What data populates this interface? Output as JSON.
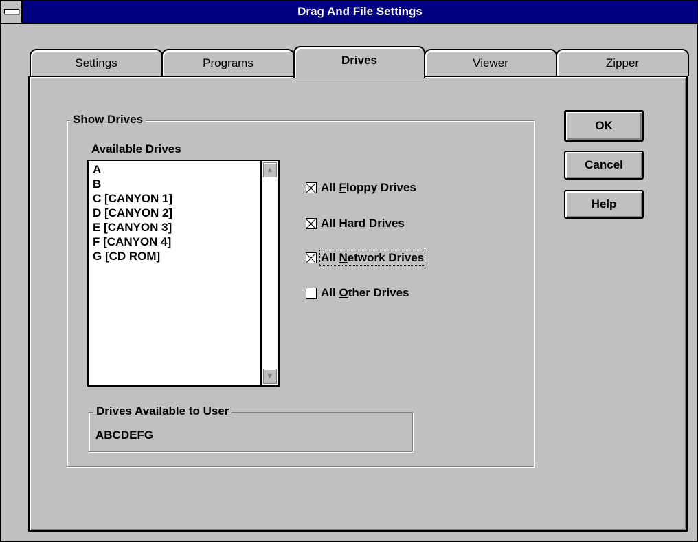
{
  "window": {
    "title": "Drag And File Settings"
  },
  "tabs": [
    {
      "label": "Settings"
    },
    {
      "label": "Programs"
    },
    {
      "label": "Drives",
      "active": true
    },
    {
      "label": "Viewer"
    },
    {
      "label": "Zipper"
    }
  ],
  "show_drives": {
    "group_label": "Show Drives",
    "available_label": "Available Drives",
    "drives": [
      "A",
      "B",
      "C [CANYON 1]",
      "D [CANYON 2]",
      "E [CANYON 3]",
      "F [CANYON 4]",
      "G [CD ROM]"
    ],
    "options": [
      {
        "pre": "All ",
        "key": "F",
        "post": "loppy Drives",
        "checked": true
      },
      {
        "pre": "All ",
        "key": "H",
        "post": "ard Drives",
        "checked": true
      },
      {
        "pre": "All ",
        "key": "N",
        "post": "etwork Drives",
        "checked": true,
        "focused": true
      },
      {
        "pre": "All ",
        "key": "O",
        "post": "ther Drives",
        "checked": false
      }
    ],
    "user_group_label": "Drives Available to User",
    "user_drives": "ABCDEFG"
  },
  "buttons": {
    "ok": "OK",
    "cancel": "Cancel",
    "help": "Help"
  }
}
